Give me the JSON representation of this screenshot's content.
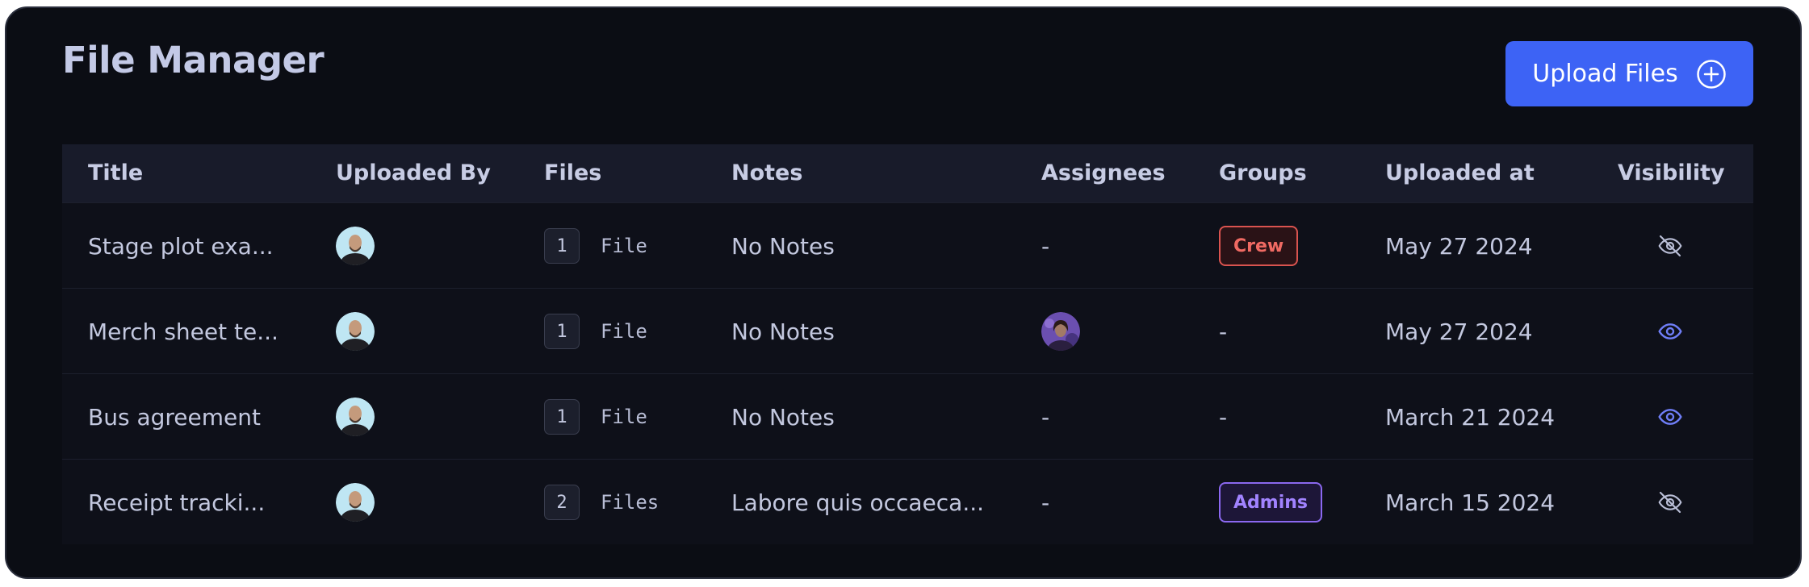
{
  "header": {
    "title": "File Manager",
    "upload_label": "Upload Files",
    "upload_icon": "plus-circle-icon"
  },
  "table": {
    "columns": [
      "Title",
      "Uploaded By",
      "Files",
      "Notes",
      "Assignees",
      "Groups",
      "Uploaded at",
      "Visibility"
    ],
    "rows": [
      {
        "title": "Stage plot exa...",
        "uploaded_by_icon": "avatar",
        "files_count": "1",
        "files_label": "File",
        "notes": "No Notes",
        "assignees": "-",
        "group": "Crew",
        "uploaded_at": "May 27 2024",
        "visibility_icon": "eye-off-icon"
      },
      {
        "title": "Merch sheet te...",
        "uploaded_by_icon": "avatar",
        "files_count": "1",
        "files_label": "File",
        "notes": "No Notes",
        "assignees_icon": "avatar",
        "group": "-",
        "uploaded_at": "May 27 2024",
        "visibility_icon": "eye-icon"
      },
      {
        "title": "Bus agreement",
        "uploaded_by_icon": "avatar",
        "files_count": "1",
        "files_label": "File",
        "notes": "No Notes",
        "assignees": "-",
        "group": "-",
        "uploaded_at": "March 21 2024",
        "visibility_icon": "eye-icon"
      },
      {
        "title": "Receipt tracki...",
        "uploaded_by_icon": "avatar",
        "files_count": "2",
        "files_label": "Files",
        "notes": "Labore quis occaeca...",
        "assignees": "-",
        "group": "Admins",
        "uploaded_at": "March 15 2024",
        "visibility_icon": "eye-off-icon"
      }
    ]
  },
  "colors": {
    "background": "#0b0d14",
    "header_row": "#181b2a",
    "accent": "#3d63f5",
    "crew_tag": "#f06a63",
    "admins_tag": "#a183ff",
    "visible_icon": "#6f7ef7"
  }
}
